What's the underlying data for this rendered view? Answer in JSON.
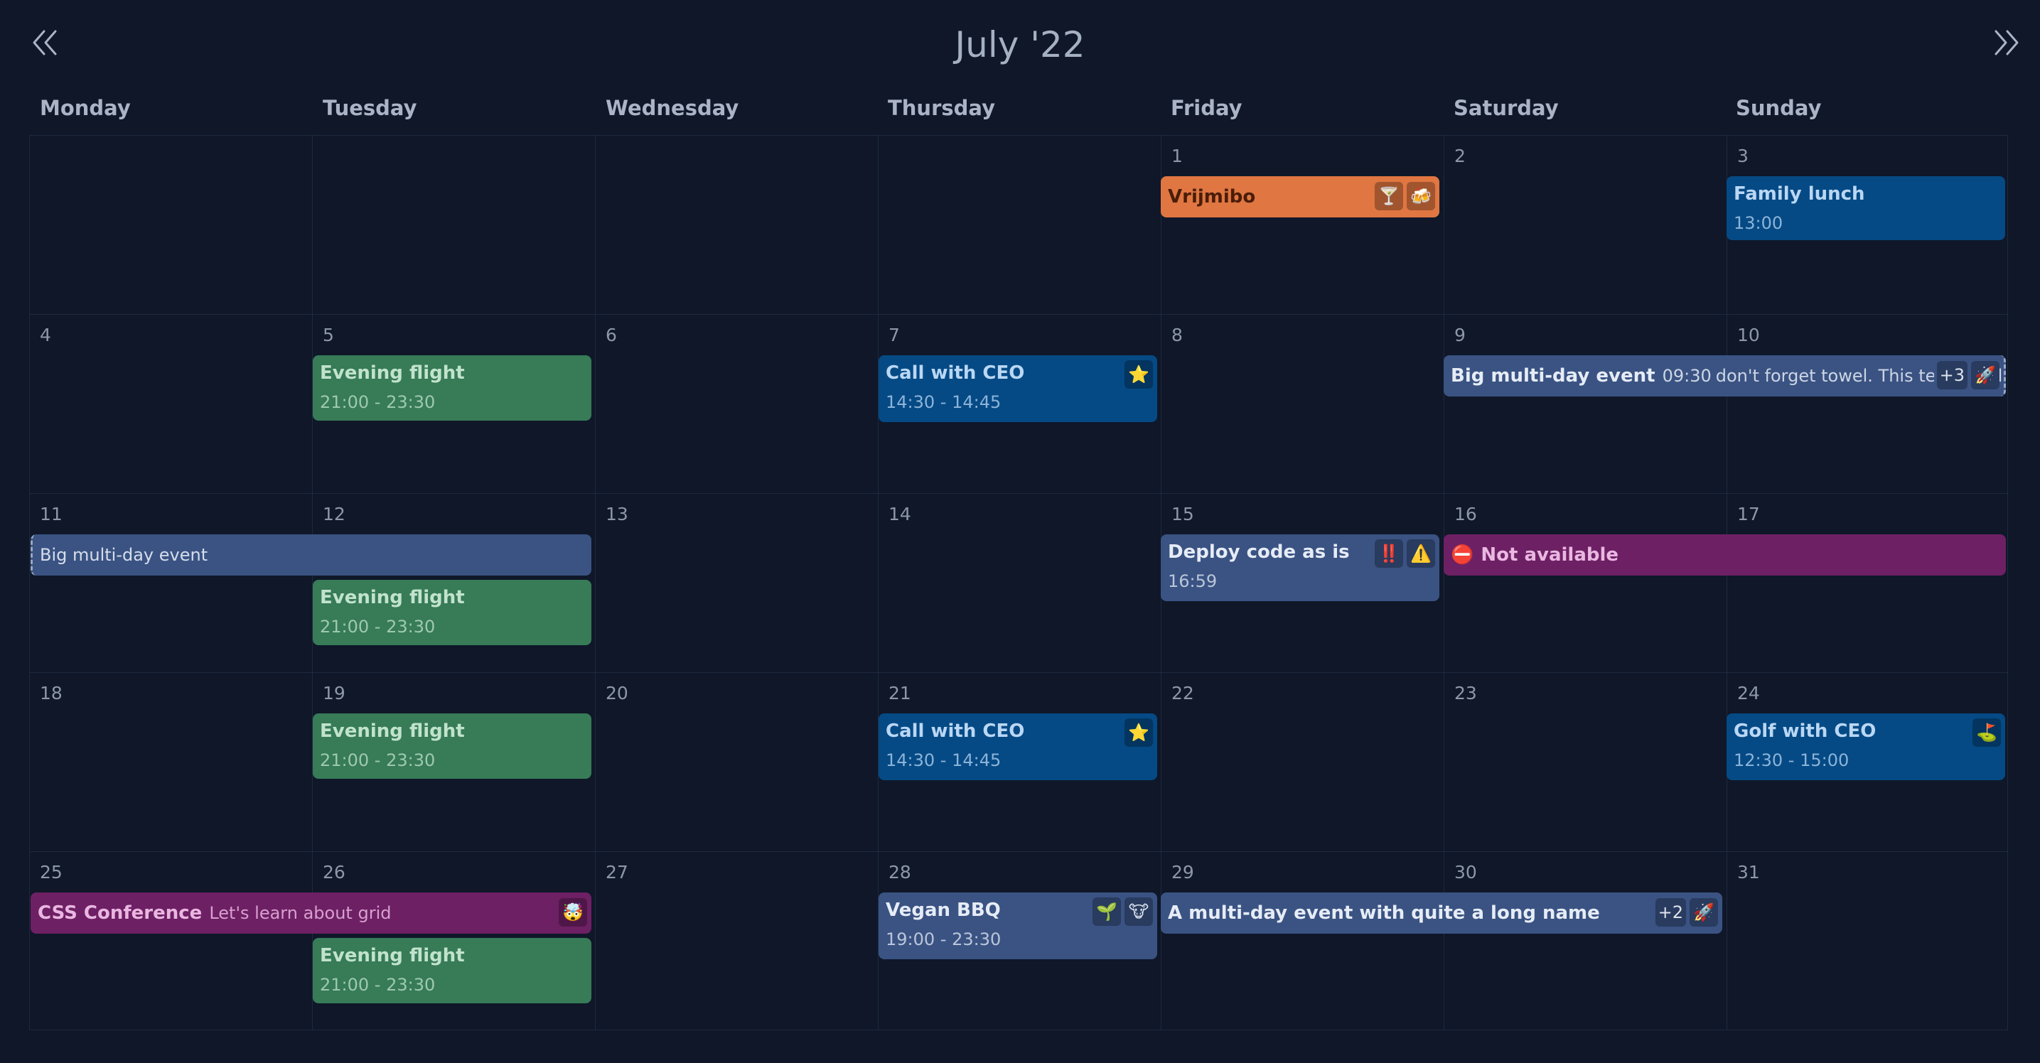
{
  "header": {
    "title": "July '22"
  },
  "weekdays": [
    "Monday",
    "Tuesday",
    "Wednesday",
    "Thursday",
    "Friday",
    "Saturday",
    "Sunday"
  ],
  "days": {
    "d1": "1",
    "d2": "2",
    "d3": "3",
    "d4": "4",
    "d5": "5",
    "d6": "6",
    "d7": "7",
    "d8": "8",
    "d9": "9",
    "d10": "10",
    "d11": "11",
    "d12": "12",
    "d13": "13",
    "d14": "14",
    "d15": "15",
    "d16": "16",
    "d17": "17",
    "d18": "18",
    "d19": "19",
    "d20": "20",
    "d21": "21",
    "d22": "22",
    "d23": "23",
    "d24": "24",
    "d25": "25",
    "d26": "26",
    "d27": "27",
    "d28": "28",
    "d29": "29",
    "d30": "30",
    "d31": "31"
  },
  "events": {
    "vrijmibo": {
      "name": "Vrijmibo",
      "icons": [
        "🍸",
        "🍻"
      ]
    },
    "family_lunch": {
      "name": "Family lunch",
      "time": "13:00"
    },
    "evening_flight": {
      "name": "Evening flight",
      "time": "21:00 - 23:30"
    },
    "call_ceo": {
      "name": "Call with CEO",
      "time": "14:30 - 14:45",
      "icon": "⭐"
    },
    "big_multi": {
      "name": "Big multi-day event",
      "time": "09:30",
      "desc": "don't forget towel. This text scroll",
      "count": "+3",
      "icon": "🚀"
    },
    "big_multi_cont": {
      "name": "Big multi-day event"
    },
    "deploy": {
      "name": "Deploy code as is",
      "time": "16:59",
      "icons": [
        "‼️",
        "⚠️"
      ]
    },
    "not_available": {
      "icon": "⛔",
      "name": "Not available"
    },
    "golf": {
      "name": "Golf with CEO",
      "time": "12:30 - 15:00",
      "icon": "⛳"
    },
    "css_conf": {
      "name": "CSS Conference",
      "desc": "Let's learn about grid",
      "icon": "🤯"
    },
    "vegan_bbq": {
      "name": "Vegan BBQ",
      "time": "19:00 - 23:30",
      "icons": [
        "🌱",
        "🐮"
      ]
    },
    "long_name": {
      "name": "A multi-day event with quite a long name",
      "count": "+2",
      "icon": "🚀"
    }
  },
  "colors": {
    "background": "#0f1729",
    "green": "#377b57",
    "blue": "#054a85",
    "slate": "#3a5383",
    "orange": "#e07641",
    "purple": "#6e2064"
  },
  "icons": {
    "prev": "double-chevron-left-icon",
    "next": "double-chevron-right-icon"
  }
}
